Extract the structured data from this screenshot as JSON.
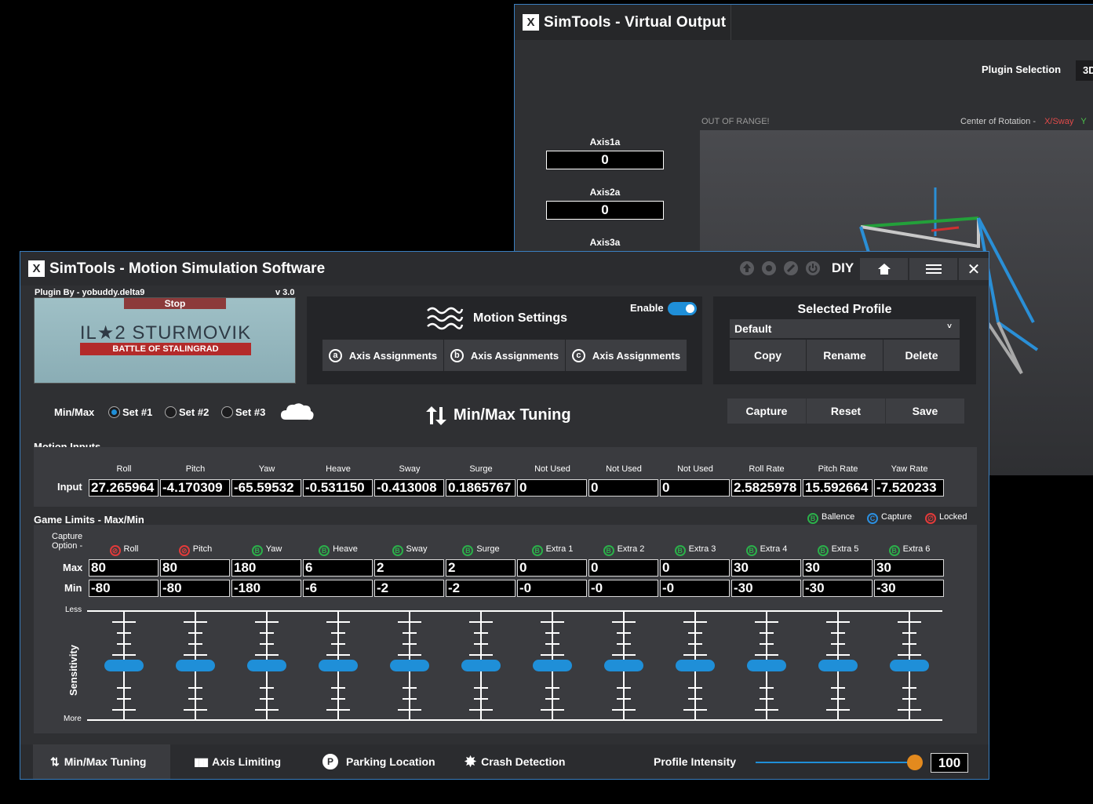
{
  "virtual_output": {
    "title": "SimTools - Virtual Output",
    "plugin_selection_label": "Plugin Selection",
    "plugin_selection_value": "3D",
    "out_of_range": "OUT OF RANGE!",
    "center_rotation": "Center of Rotation  -",
    "center_rotation_axis": "X/Sway",
    "center_rotation_axis2": "Y",
    "axes": [
      {
        "label": "Axis1a",
        "value": "0"
      },
      {
        "label": "Axis2a",
        "value": "0"
      },
      {
        "label": "Axis3a",
        "value": ""
      }
    ]
  },
  "main": {
    "title": "SimTools - Motion Simulation Software",
    "diy": "DIY",
    "plugin": {
      "by": "Plugin By - yobuddy.delta9",
      "version": "v 3.0",
      "stop": "Stop",
      "game_title": "IL★2 STURMOVIK",
      "game_subtitle": "BATTLE OF STALINGRAD"
    },
    "motion_settings": {
      "title": "Motion Settings",
      "enable": "Enable",
      "enabled": true,
      "axis_buttons": [
        {
          "letter": "a",
          "label": "Axis Assignments"
        },
        {
          "letter": "b",
          "label": "Axis Assignments"
        },
        {
          "letter": "c",
          "label": "Axis Assignments"
        }
      ]
    },
    "profile": {
      "title": "Selected Profile",
      "value": "Default",
      "copy": "Copy",
      "rename": "Rename",
      "delete": "Delete"
    },
    "minmax": {
      "label": "Min/Max",
      "sets": [
        "Set #1",
        "Set #2",
        "Set #3"
      ],
      "selected": 0,
      "title": "Min/Max Tuning",
      "capture": "Capture",
      "reset": "Reset",
      "save": "Save"
    },
    "motion_inputs": {
      "title": "Motion Inputs",
      "row_label": "Input",
      "columns": [
        "Roll",
        "Pitch",
        "Yaw",
        "Heave",
        "Sway",
        "Surge",
        "Not Used",
        "Not Used",
        "Not Used",
        "Roll Rate",
        "Pitch Rate",
        "Yaw Rate"
      ],
      "values": [
        "27.265964",
        "-4.170309",
        "-65.59532",
        "-0.531150",
        "-0.413008",
        "0.1865767",
        "0",
        "0",
        "0",
        "2.5825978",
        "15.592664",
        "-7.520233"
      ]
    },
    "game_limits": {
      "title": "Game Limits - Max/Min",
      "legend": [
        {
          "letter": "B",
          "label": "Ballence",
          "color": "green"
        },
        {
          "letter": "C",
          "label": "Capture",
          "color": "blue"
        },
        {
          "letter": "∅",
          "label": "Locked",
          "color": "red"
        }
      ],
      "capture_option": "Capture\nOption -",
      "max_label": "Max",
      "min_label": "Min",
      "columns": [
        {
          "name": "Roll",
          "badge": "locked"
        },
        {
          "name": "Pitch",
          "badge": "locked"
        },
        {
          "name": "Yaw",
          "badge": "B"
        },
        {
          "name": "Heave",
          "badge": "B"
        },
        {
          "name": "Sway",
          "badge": "B"
        },
        {
          "name": "Surge",
          "badge": "B"
        },
        {
          "name": "Extra 1",
          "badge": "B"
        },
        {
          "name": "Extra 2",
          "badge": "B"
        },
        {
          "name": "Extra 3",
          "badge": "B"
        },
        {
          "name": "Extra 4",
          "badge": "B"
        },
        {
          "name": "Extra 5",
          "badge": "B"
        },
        {
          "name": "Extra 6",
          "badge": "B"
        }
      ],
      "max": [
        "80",
        "80",
        "180",
        "6",
        "2",
        "2",
        "0",
        "0",
        "0",
        "30",
        "30",
        "30"
      ],
      "min": [
        "-80",
        "-80",
        "-180",
        "-6",
        "-2",
        "-2",
        "-0",
        "-0",
        "-0",
        "-30",
        "-30",
        "-30"
      ],
      "sensitivity_label": "Sensitivity",
      "less": "Less",
      "more": "More",
      "sensitivity": [
        0.5,
        0.5,
        0.5,
        0.5,
        0.5,
        0.5,
        0.5,
        0.5,
        0.5,
        0.5,
        0.5,
        0.5
      ]
    },
    "bottom": {
      "tabs": [
        "Min/Max Tuning",
        "Axis Limiting",
        "Parking Location",
        "Crash Detection"
      ],
      "active": 0,
      "intensity_label": "Profile Intensity",
      "intensity_value": "100",
      "intensity": 1.0
    },
    "colors": {
      "accent": "#1f8fd8",
      "slider_knob": "#e38a1e",
      "frame": "#3a7fc0"
    }
  }
}
